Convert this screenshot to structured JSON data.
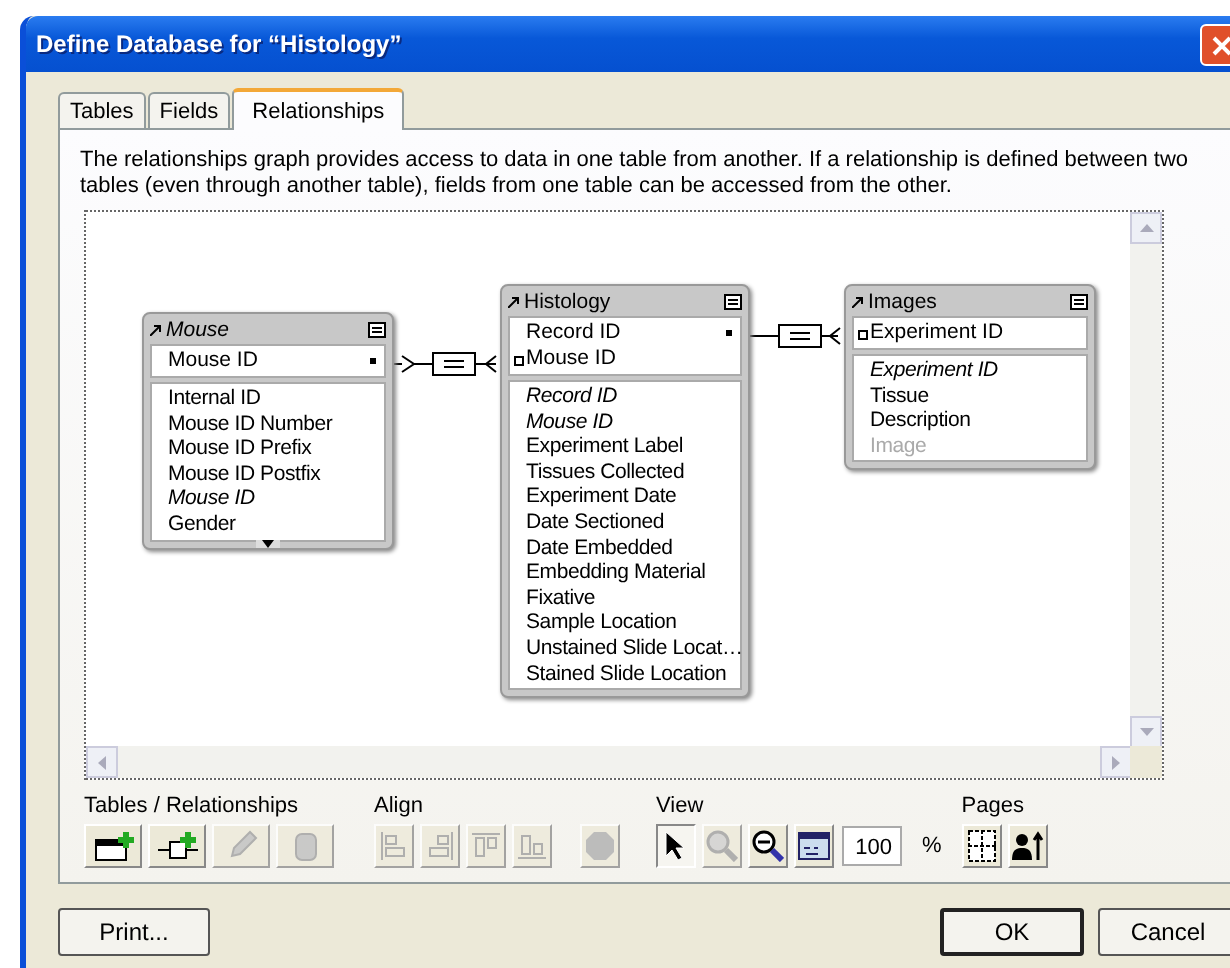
{
  "window": {
    "title": "Define Database for “Histology”"
  },
  "tabs": [
    {
      "label": "Tables",
      "selected": false
    },
    {
      "label": "Fields",
      "selected": false
    },
    {
      "label": "Relationships",
      "selected": true
    }
  ],
  "description": "The relationships graph provides access to data in one table from another. If a relationship is defined between two tables (even through another table), fields from one table can be accessed from the other.",
  "graph": {
    "tables": [
      {
        "name": "Mouse",
        "italic": true,
        "more_below": true,
        "match_fields": [
          {
            "name": "Mouse ID",
            "linked_on_right": true
          }
        ],
        "fields": [
          {
            "name": "Internal ID",
            "kind": "plain"
          },
          {
            "name": "Mouse ID Number",
            "kind": "plain"
          },
          {
            "name": "Mouse ID Prefix",
            "kind": "plain"
          },
          {
            "name": "Mouse ID Postfix",
            "kind": "plain"
          },
          {
            "name": "Mouse ID",
            "kind": "italic"
          },
          {
            "name": "Gender",
            "kind": "plain"
          }
        ]
      },
      {
        "name": "Histology",
        "italic": false,
        "more_below": false,
        "match_fields": [
          {
            "name": "Record ID",
            "linked_on_right": true
          },
          {
            "name": "Mouse ID",
            "linked_on_right": false
          }
        ],
        "fields": [
          {
            "name": "Record ID",
            "kind": "italic"
          },
          {
            "name": "Mouse ID",
            "kind": "italic"
          },
          {
            "name": "Experiment Label",
            "kind": "plain"
          },
          {
            "name": "Tissues Collected",
            "kind": "plain"
          },
          {
            "name": "Experiment Date",
            "kind": "plain"
          },
          {
            "name": "Date Sectioned",
            "kind": "plain"
          },
          {
            "name": "Date Embedded",
            "kind": "plain"
          },
          {
            "name": "Embedding Material",
            "kind": "plain"
          },
          {
            "name": "Fixative",
            "kind": "plain"
          },
          {
            "name": "Sample Location",
            "kind": "plain"
          },
          {
            "name": "Unstained Slide Locat…",
            "kind": "plain"
          },
          {
            "name": "Stained Slide Location",
            "kind": "plain"
          }
        ]
      },
      {
        "name": "Images",
        "italic": false,
        "more_below": false,
        "match_fields": [
          {
            "name": "Experiment ID",
            "linked_on_right": false
          }
        ],
        "fields": [
          {
            "name": "Experiment ID",
            "kind": "italic"
          },
          {
            "name": "Tissue",
            "kind": "plain"
          },
          {
            "name": "Description",
            "kind": "plain"
          },
          {
            "name": "Image",
            "kind": "dimmed"
          }
        ]
      }
    ]
  },
  "toolbar": {
    "groups": [
      {
        "label": "Tables / Relationships",
        "buttons": [
          {
            "disabled": false,
            "selected": false
          },
          {
            "disabled": false,
            "selected": false
          },
          {
            "disabled": true,
            "selected": false
          },
          {
            "disabled": true,
            "selected": false
          }
        ]
      },
      {
        "label": "Align",
        "buttons": [
          {
            "disabled": true,
            "selected": false
          },
          {
            "disabled": true,
            "selected": false
          },
          {
            "disabled": true,
            "selected": false
          },
          {
            "disabled": true,
            "selected": false
          }
        ]
      },
      {
        "buttons": [
          {
            "disabled": true,
            "selected": false
          }
        ]
      },
      {
        "label": "View",
        "buttons": [
          {
            "disabled": false,
            "selected": true
          },
          {
            "disabled": true,
            "selected": false
          },
          {
            "disabled": false,
            "selected": false
          },
          {
            "disabled": false,
            "selected": false
          }
        ],
        "zoom": {
          "value": "100",
          "unit": "%"
        }
      },
      {
        "label": "Pages",
        "buttons": [
          {
            "disabled": false,
            "selected": false
          },
          {
            "disabled": false,
            "selected": false
          }
        ]
      }
    ]
  },
  "buttons": {
    "print": "Print...",
    "ok": "OK",
    "cancel": "Cancel"
  }
}
